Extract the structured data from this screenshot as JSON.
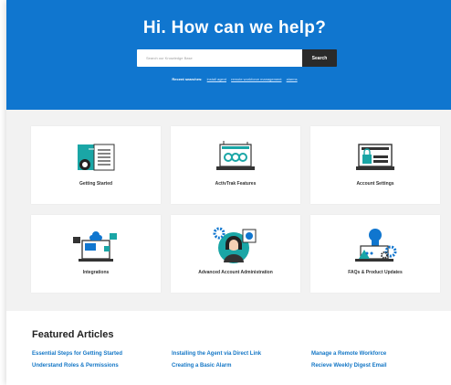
{
  "hero": {
    "title": "Hi. How can we help?",
    "search_placeholder": "Search our Knowledge Base",
    "search_button": "Search",
    "recent_label": "Recent searches:",
    "recent_links": [
      "install agent",
      "remote workforce management",
      "alarms"
    ]
  },
  "categories": [
    {
      "label": "Getting Started",
      "icon": "getting-started-icon"
    },
    {
      "label": "ActivTrak Features",
      "icon": "features-icon"
    },
    {
      "label": "Account Settings",
      "icon": "account-settings-icon"
    },
    {
      "label": "Integrations",
      "icon": "integrations-icon"
    },
    {
      "label": "Advanced Account Administration",
      "icon": "advanced-admin-icon"
    },
    {
      "label": "FAQs & Product Updates",
      "icon": "faqs-icon"
    }
  ],
  "featured": {
    "title": "Featured Articles",
    "articles": [
      "Essential Steps for Getting Started",
      "Installing the Agent via Direct Link",
      "Manage a Remote Workforce",
      "Understand Roles & Permissions",
      "Creating a Basic Alarm",
      "Recieve Weekly Digest Email"
    ]
  },
  "colors": {
    "hero_blue": "#1076cf",
    "link_blue": "#1477c6",
    "teal": "#1aa6a6"
  }
}
